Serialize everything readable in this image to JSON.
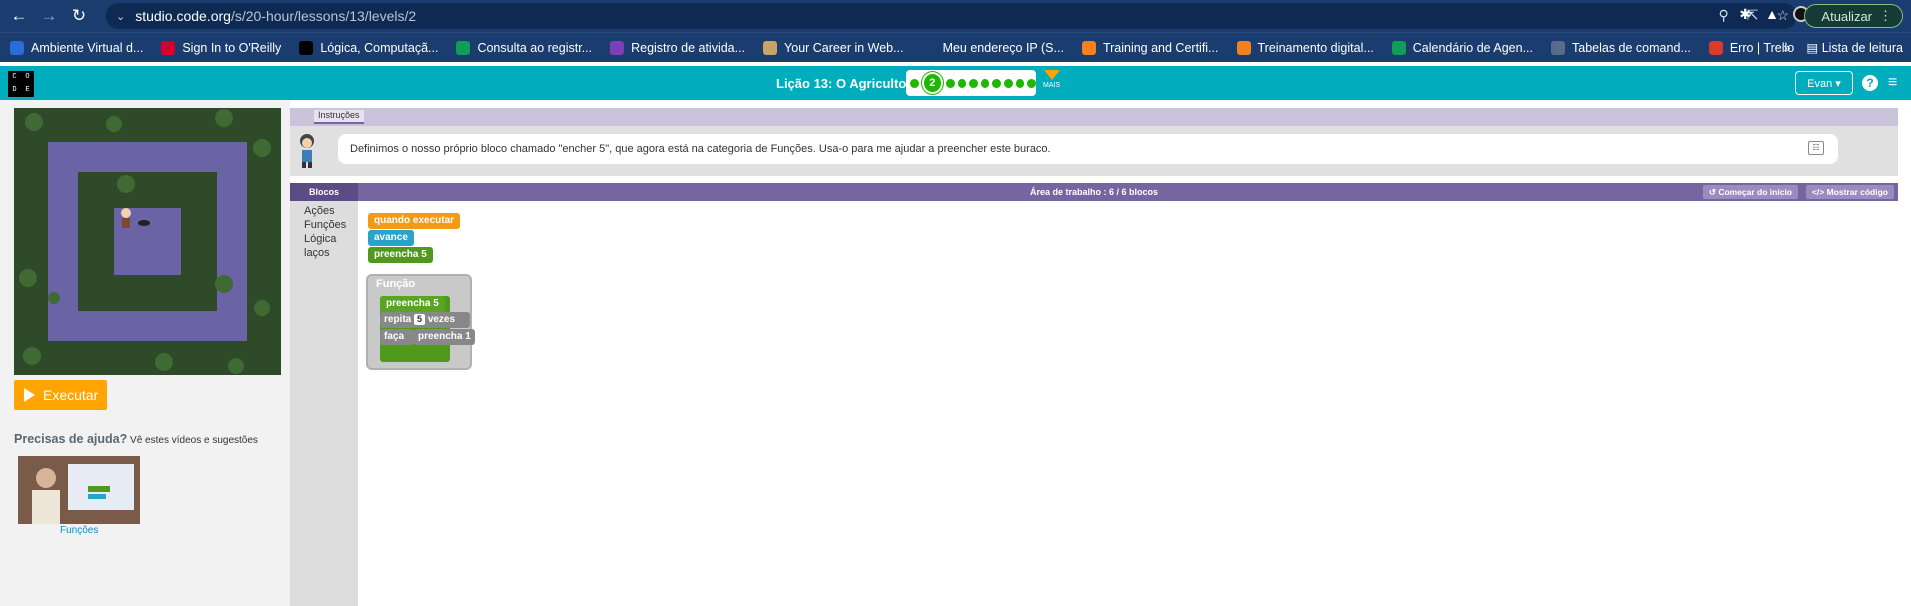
{
  "browser": {
    "url_host": "studio.code.org",
    "url_path": "/s/20-hour/lessons/13/levels/2",
    "update_label": "Atualizar",
    "bookmarks": [
      {
        "label": "Ambiente Virtual d...",
        "color": "#2a6dd9"
      },
      {
        "label": "Sign In to O'Reilly",
        "color": "#d3002d"
      },
      {
        "label": "Lógica, Computaçã...",
        "color": "#000000"
      },
      {
        "label": "Consulta ao registr...",
        "color": "#0f9d58"
      },
      {
        "label": "Registro de ativida...",
        "color": "#7b3fb8"
      },
      {
        "label": "Your Career in Web...",
        "color": "#c9a46a"
      },
      {
        "label": "Meu endereço IP (S...",
        "color": "#1b3c6e"
      },
      {
        "label": "Training and Certifi...",
        "color": "#f48120"
      },
      {
        "label": "Treinamento digital...",
        "color": "#f48120"
      },
      {
        "label": "Calendário de Agen...",
        "color": "#0f9d58"
      },
      {
        "label": "Tabelas de comand...",
        "color": "#5b6b8c"
      },
      {
        "label": "Erro | Trello",
        "color": "#d93a2b"
      }
    ],
    "bookmarks_more": "»",
    "reading_list": "Lista de leitura"
  },
  "header": {
    "lesson_title": "Lição 13: O Agricultor 2",
    "current_level": "2",
    "more_label": "MAIS",
    "user_label": "Evan ▾",
    "help_symbol": "?",
    "menu_symbol": "≡"
  },
  "left": {
    "run_label": "Executar",
    "help_title": "Precisas de ajuda?",
    "help_subtitle": " Vê estes vídeos e sugestões",
    "video_label": "Funções"
  },
  "instructions": {
    "tab_label": "Instruções",
    "text": "Definimos o nosso próprio bloco chamado \"encher 5\", que agora está na categoria de Funções. Usa-o para me ajudar a preencher este buraco."
  },
  "workspace": {
    "blocks_label": "Blocos",
    "count_label": "Área de trabalho : 6 / 6 blocos",
    "reset_label": "Começar do início",
    "show_code_label": "Mostrar código",
    "toolbox": [
      "Ações",
      "Funções",
      "Lógica",
      "laços"
    ],
    "program": {
      "when_run": "quando executar",
      "move": "avance",
      "fill5": "preencha 5"
    },
    "function": {
      "header": "Função",
      "name": "preencha 5",
      "repeat": "repita",
      "repeat_count": "5",
      "times": "vezes",
      "do": "faça",
      "inner": "preencha 1"
    }
  },
  "colors": {
    "header_teal": "#00adbc",
    "workspace_purple": "#7665a0",
    "run_orange": "#ffa400",
    "progress_green": "#1db800"
  }
}
